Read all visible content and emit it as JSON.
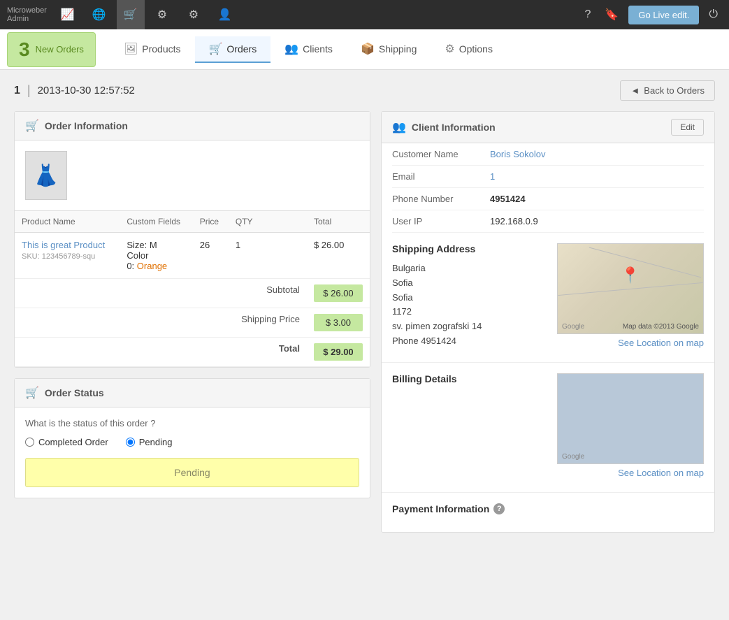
{
  "app": {
    "title": "Microweber",
    "subtitle": "Admin"
  },
  "top_nav": {
    "icons": [
      {
        "name": "analytics-icon",
        "symbol": "📈"
      },
      {
        "name": "globe-icon",
        "symbol": "🌐"
      },
      {
        "name": "cart-icon",
        "symbol": "🛒"
      },
      {
        "name": "workflow-icon",
        "symbol": "⚙"
      },
      {
        "name": "settings-icon",
        "symbol": "⚙"
      },
      {
        "name": "users-icon",
        "symbol": "👤"
      }
    ],
    "go_live_label": "Go Live edit.",
    "help_symbol": "?",
    "bookmark_symbol": "🔖",
    "power_symbol": "⏻"
  },
  "new_orders": {
    "count": "3",
    "label": "New Orders"
  },
  "nav_tabs": [
    {
      "id": "products",
      "label": "Products",
      "icon": "🖼"
    },
    {
      "id": "orders",
      "label": "Orders",
      "icon": "🛒",
      "active": true
    },
    {
      "id": "clients",
      "label": "Clients",
      "icon": "👥"
    },
    {
      "id": "shipping",
      "label": "Shipping",
      "icon": "📦"
    },
    {
      "id": "options",
      "label": "Options",
      "icon": "⚙"
    }
  ],
  "order": {
    "id": "1",
    "separator": "|",
    "date": "2013-10-30 12:57:52",
    "back_button": "Back to Orders"
  },
  "order_info": {
    "panel_title": "Order Information",
    "product_image_symbol": "👗",
    "table_headers": [
      "Product Name",
      "Custom Fields",
      "Price",
      "QTY",
      "Total"
    ],
    "product_name": "This is great Product",
    "product_sku": "SKU: 123456789-squ",
    "custom_size_label": "Size:",
    "custom_size_value": "M",
    "custom_color_label": "Color",
    "custom_color_value": "Orange",
    "custom_color_prefix": "0:",
    "price": "26",
    "qty": "1",
    "total": "$ 26.00",
    "subtotal_label": "Subtotal",
    "subtotal_value": "$ 26.00",
    "shipping_price_label": "Shipping Price",
    "shipping_price_value": "$ 3.00",
    "total_label": "Total",
    "total_value": "$ 29.00"
  },
  "order_status": {
    "panel_title": "Order Status",
    "question": "What is the status of this order ?",
    "option_completed": "Completed Order",
    "option_pending": "Pending",
    "current_status": "Pending"
  },
  "client_info": {
    "panel_title": "Client Information",
    "edit_label": "Edit",
    "customer_name_label": "Customer Name",
    "customer_name": "Boris Sokolov",
    "email_label": "Email",
    "email_value": "1",
    "phone_label": "Phone Number",
    "phone_value": "4951424",
    "user_ip_label": "User IP",
    "user_ip_value": "192.168.0.9"
  },
  "shipping": {
    "title": "Shipping Address",
    "country": "Bulgaria",
    "city1": "Sofia",
    "city2": "Sofia",
    "postal": "1172",
    "street": "sv. pimen zografski 14",
    "phone_label": "Phone",
    "phone": "4951424",
    "map_data_label": "Map data ©2013 Google",
    "see_location_label": "See Location on map"
  },
  "billing": {
    "title": "Billing Details",
    "see_location_label": "See Location on map"
  },
  "payment": {
    "title": "Payment Information",
    "help_symbol": "?"
  }
}
